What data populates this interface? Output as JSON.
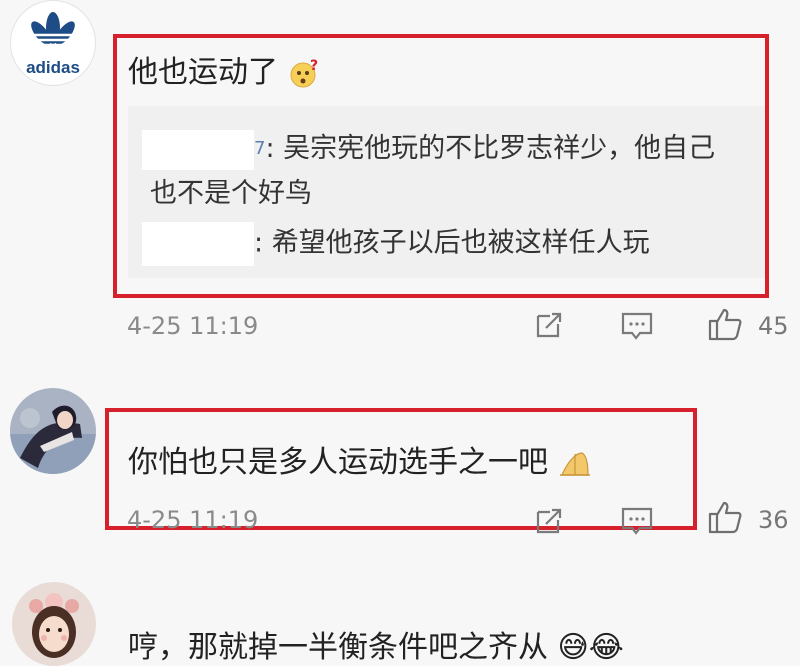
{
  "comments": [
    {
      "avatar": "adidas-logo-avatar",
      "avatar_text": "adidas",
      "text": "他也运动了",
      "emoji": "confused-face-emoji",
      "replies": [
        {
          "user_suffix": "7",
          "text": "吴宗宪他玩的不比罗志祥少，他自己",
          "text2": "也不是个好鸟"
        },
        {
          "text": "希望他孩子以后也被这样任人玩"
        }
      ],
      "time": "4-25 11:19",
      "likes": "45"
    },
    {
      "avatar": "anime-girl-avatar",
      "text": "你怕也只是多人运动选手之一吧",
      "emoji": "folded-hands-emoji",
      "time": "4-25 11:19",
      "likes": "36"
    },
    {
      "avatar": "girl-photo-avatar",
      "text": "哼，那就掉一半衡条件吧之齐从 😅😂"
    }
  ],
  "colors": {
    "highlight": "#d6202c",
    "meta": "#8a8a8a",
    "background": "#f7f7f7"
  }
}
